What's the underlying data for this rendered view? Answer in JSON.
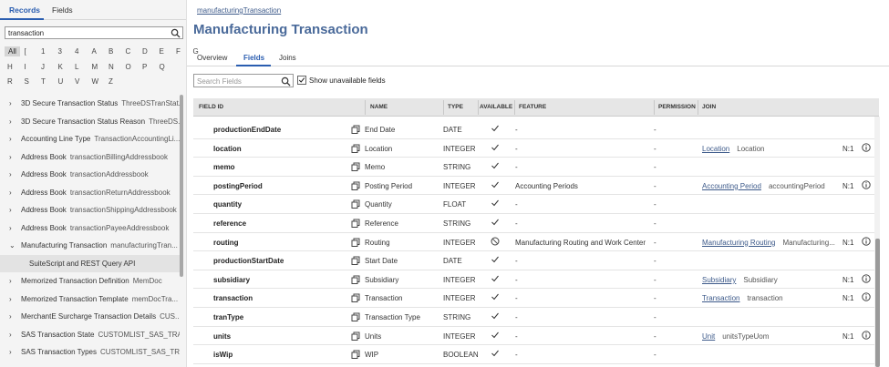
{
  "left": {
    "tabs": {
      "records": "Records",
      "fields": "Fields"
    },
    "search_value": "transaction",
    "alphabet": [
      "All",
      "[",
      "1",
      "3",
      "4",
      "A",
      "B",
      "C",
      "D",
      "E",
      "F",
      "G",
      "H",
      "I",
      "J",
      "K",
      "L",
      "M",
      "N",
      "O",
      "P",
      "Q",
      "R",
      "S",
      "T",
      "U",
      "V",
      "W",
      "Z"
    ],
    "records": [
      {
        "chev": "›",
        "label": "3D Secure Transaction Status",
        "id": "ThreeDSTranStat..."
      },
      {
        "chev": "›",
        "label": "3D Secure Transaction Status Reason",
        "id": "ThreeDS..."
      },
      {
        "chev": "›",
        "label": "Accounting Line Type",
        "id": "TransactionAccountingLi..."
      },
      {
        "chev": "›",
        "label": "Address Book",
        "id": "transactionBillingAddressbook"
      },
      {
        "chev": "›",
        "label": "Address Book",
        "id": "transactionAddressbook"
      },
      {
        "chev": "›",
        "label": "Address Book",
        "id": "transactionReturnAddressbook"
      },
      {
        "chev": "›",
        "label": "Address Book",
        "id": "transactionShippingAddressbook"
      },
      {
        "chev": "›",
        "label": "Address Book",
        "id": "transactionPayeeAddressbook"
      },
      {
        "chev": "⌄",
        "label": "Manufacturing Transaction",
        "id": "manufacturingTran..."
      },
      {
        "chev": "",
        "label": "SuiteScript and REST Query API",
        "id": "",
        "sub": true
      },
      {
        "chev": "›",
        "label": "Memorized Transaction Definition",
        "id": "MemDoc"
      },
      {
        "chev": "›",
        "label": "Memorized Transaction Template",
        "id": "memDocTra..."
      },
      {
        "chev": "›",
        "label": "MerchantE Surcharge Transaction Details",
        "id": "CUS..."
      },
      {
        "chev": "›",
        "label": "SAS Transaction State",
        "id": "CUSTOMLIST_SAS_TRAN..."
      },
      {
        "chev": "›",
        "label": "SAS Transaction Types",
        "id": "CUSTOMLIST_SAS_TRA..."
      }
    ]
  },
  "breadcrumb": "manufacturingTransaction",
  "title": "Manufacturing Transaction",
  "tabs": [
    "Overview",
    "Fields",
    "Joins"
  ],
  "field_search_placeholder": "Search Fields",
  "show_unavailable_label": "Show unavailable fields",
  "columns": {
    "field_id": "FIELD ID",
    "name": "NAME",
    "type": "TYPE",
    "available": "AVAILABLE",
    "feature": "FEATURE",
    "permission": "PERMISSION",
    "join": "JOIN"
  },
  "rows": [
    {
      "field_id": "productionEndDate",
      "name": "End Date",
      "type": "DATE",
      "avail": "check",
      "feature": "-",
      "permission": "-",
      "join": "",
      "join_desc": "",
      "card": ""
    },
    {
      "field_id": "location",
      "name": "Location",
      "type": "INTEGER",
      "avail": "check",
      "feature": "-",
      "permission": "-",
      "join": "Location",
      "join_desc": "Location",
      "card": "N:1"
    },
    {
      "field_id": "memo",
      "name": "Memo",
      "type": "STRING",
      "avail": "check",
      "feature": "-",
      "permission": "-",
      "join": "",
      "join_desc": "",
      "card": ""
    },
    {
      "field_id": "postingPeriod",
      "name": "Posting Period",
      "type": "INTEGER",
      "avail": "check",
      "feature": "Accounting Periods",
      "permission": "-",
      "join": "Accounting Period",
      "join_desc": "accountingPeriod",
      "card": "N:1"
    },
    {
      "field_id": "quantity",
      "name": "Quantity",
      "type": "FLOAT",
      "avail": "check",
      "feature": "-",
      "permission": "-",
      "join": "",
      "join_desc": "",
      "card": ""
    },
    {
      "field_id": "reference",
      "name": "Reference",
      "type": "STRING",
      "avail": "check",
      "feature": "-",
      "permission": "-",
      "join": "",
      "join_desc": "",
      "card": ""
    },
    {
      "field_id": "routing",
      "name": "Routing",
      "type": "INTEGER",
      "avail": "blocked",
      "feature": "Manufacturing Routing and Work Center",
      "permission": "-",
      "join": "Manufacturing Routing",
      "join_desc": "Manufacturing...",
      "card": "N:1"
    },
    {
      "field_id": "productionStartDate",
      "name": "Start Date",
      "type": "DATE",
      "avail": "check",
      "feature": "-",
      "permission": "-",
      "join": "",
      "join_desc": "",
      "card": ""
    },
    {
      "field_id": "subsidiary",
      "name": "Subsidiary",
      "type": "INTEGER",
      "avail": "check",
      "feature": "-",
      "permission": "-",
      "join": "Subsidiary",
      "join_desc": "Subsidiary",
      "card": "N:1"
    },
    {
      "field_id": "transaction",
      "name": "Transaction",
      "type": "INTEGER",
      "avail": "check",
      "feature": "-",
      "permission": "-",
      "join": "Transaction",
      "join_desc": "transaction",
      "card": "N:1"
    },
    {
      "field_id": "tranType",
      "name": "Transaction Type",
      "type": "STRING",
      "avail": "check",
      "feature": "-",
      "permission": "-",
      "join": "",
      "join_desc": "",
      "card": ""
    },
    {
      "field_id": "units",
      "name": "Units",
      "type": "INTEGER",
      "avail": "check",
      "feature": "-",
      "permission": "-",
      "join": "Unit",
      "join_desc": "unitsTypeUom",
      "card": "N:1"
    },
    {
      "field_id": "isWip",
      "name": "WIP",
      "type": "BOOLEAN",
      "avail": "check",
      "feature": "-",
      "permission": "-",
      "join": "",
      "join_desc": "",
      "card": ""
    }
  ]
}
